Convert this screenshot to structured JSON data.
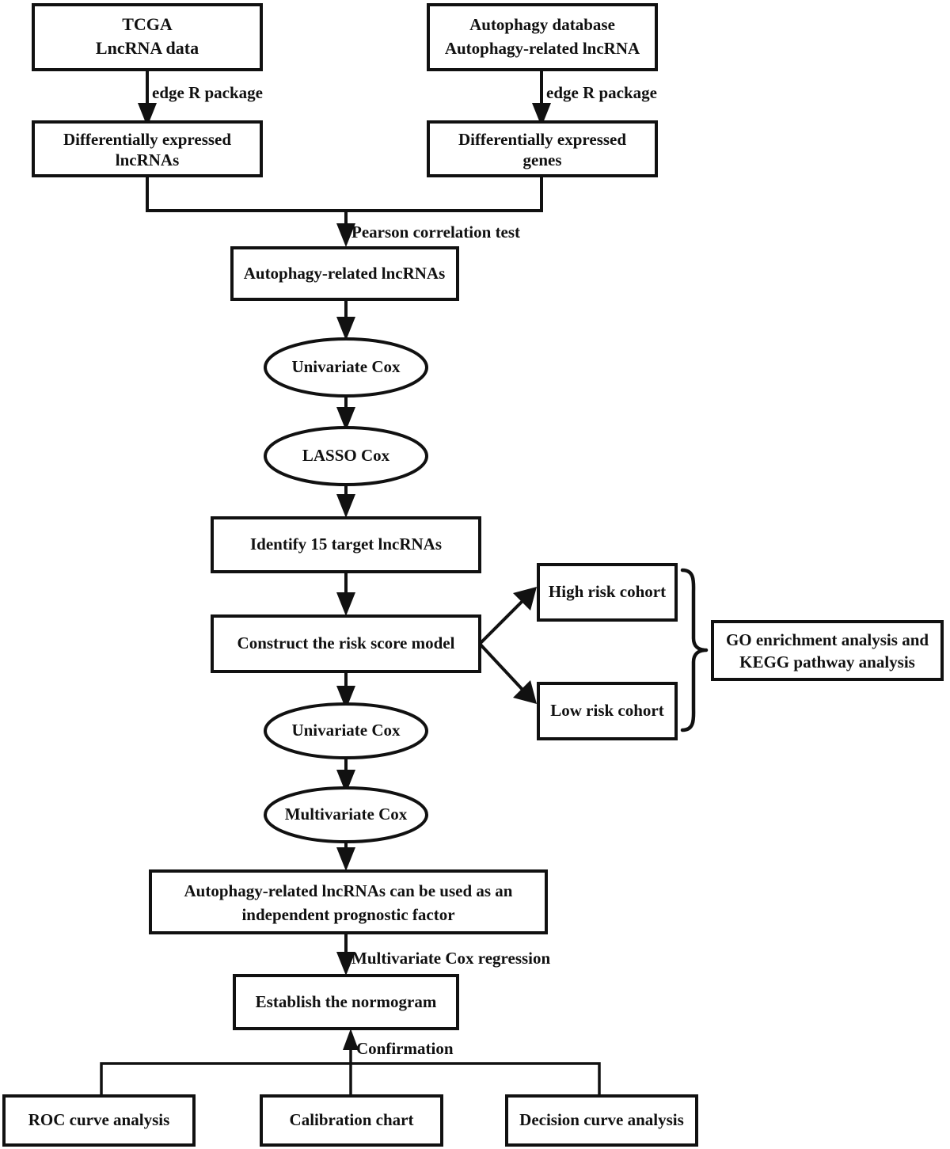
{
  "diagram": {
    "type": "flowchart",
    "title": "Autophagy-related lncRNA prognostic model study workflow",
    "orientation": "top-to-bottom",
    "colors": {
      "background": "#ffffff",
      "stroke": "#111111",
      "text": "#111111",
      "fill": "#ffffff"
    },
    "nodes": {
      "tcga_lncrna_data": {
        "shape": "rectangle",
        "line1": "TCGA",
        "line2": "LncRNA data"
      },
      "autophagy_database": {
        "shape": "rectangle",
        "line1": "Autophagy database",
        "line2": "Autophagy-related lncRNA"
      },
      "deg_lncrnas": {
        "shape": "rectangle",
        "line1": "Differentially expressed",
        "line2": "lncRNAs"
      },
      "deg_genes": {
        "shape": "rectangle",
        "line1": "Differentially expressed",
        "line2": "genes"
      },
      "autophagy_related_lncrnas": {
        "shape": "rectangle",
        "line1": "Autophagy-related lncRNAs"
      },
      "univariate_cox_1": {
        "shape": "ellipse",
        "line1": "Univariate Cox"
      },
      "lasso_cox": {
        "shape": "ellipse",
        "line1": "LASSO Cox"
      },
      "identify_targets": {
        "shape": "rectangle",
        "line1": "Identify 15 target lncRNAs"
      },
      "risk_score_model": {
        "shape": "rectangle",
        "line1": "Construct the risk score model"
      },
      "high_risk_cohort": {
        "shape": "rectangle",
        "line1": "High risk cohort"
      },
      "low_risk_cohort": {
        "shape": "rectangle",
        "line1": "Low risk cohort"
      },
      "go_kegg_analysis": {
        "shape": "rectangle",
        "line1": "GO enrichment analysis and",
        "line2": "KEGG pathway analysis"
      },
      "univariate_cox_2": {
        "shape": "ellipse",
        "line1": "Univariate Cox"
      },
      "multivariate_cox": {
        "shape": "ellipse",
        "line1": "Multivariate Cox"
      },
      "independent_prognostic_factor": {
        "shape": "rectangle",
        "line1": "Autophagy-related lncRNAs can be used as an",
        "line2": "independent prognostic factor"
      },
      "establish_normogram": {
        "shape": "rectangle",
        "line1": "Establish the normogram"
      },
      "roc_curve_analysis": {
        "shape": "rectangle",
        "line1": "ROC curve analysis"
      },
      "calibration_chart": {
        "shape": "rectangle",
        "line1": "Calibration chart"
      },
      "decision_curve_analysis": {
        "shape": "rectangle",
        "line1": "Decision curve analysis"
      }
    },
    "edge_labels": {
      "edge_r_package_left": "edge R package",
      "edge_r_package_right": "edge R package",
      "pearson_correlation_test": "Pearson correlation test",
      "multivariate_cox_regression": "Multivariate Cox regression",
      "confirmation": "Confirmation"
    }
  }
}
